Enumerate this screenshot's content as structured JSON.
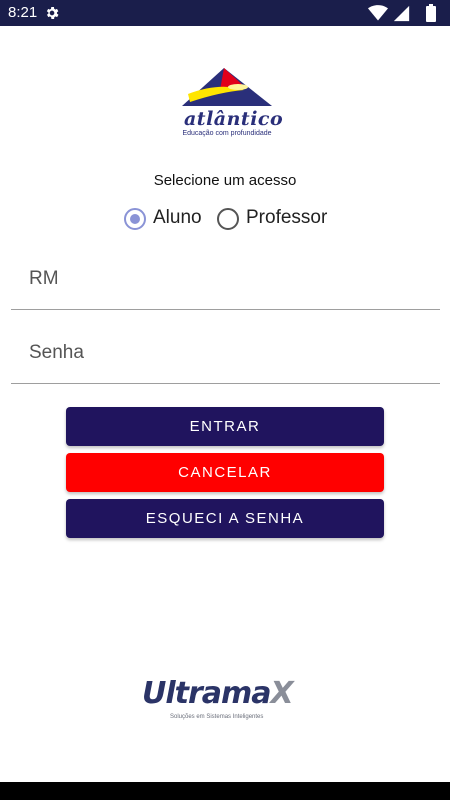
{
  "status_bar": {
    "time": "8:21",
    "icons": [
      "gear-icon",
      "wifi-icon",
      "signal-icon",
      "battery-icon"
    ]
  },
  "logo": {
    "word": "atlântico",
    "tagline": "Educação com profundidade"
  },
  "access": {
    "label": "Selecione um acesso",
    "options": [
      "Aluno",
      "Professor"
    ],
    "selected": "Aluno"
  },
  "form": {
    "rm_placeholder": "RM",
    "password_placeholder": "Senha"
  },
  "buttons": {
    "enter": "ENTRAR",
    "cancel": "CANCELAR",
    "forgot": "ESQUECI A SENHA"
  },
  "brand": {
    "word": "Ultrama",
    "x": "X",
    "tagline": "Soluções em Sistemas Inteligentes"
  },
  "colors": {
    "primary": "#20145e",
    "danger": "#ff0000",
    "status_bar": "#1a1e4b",
    "radio_accent": "#8a93d6"
  }
}
